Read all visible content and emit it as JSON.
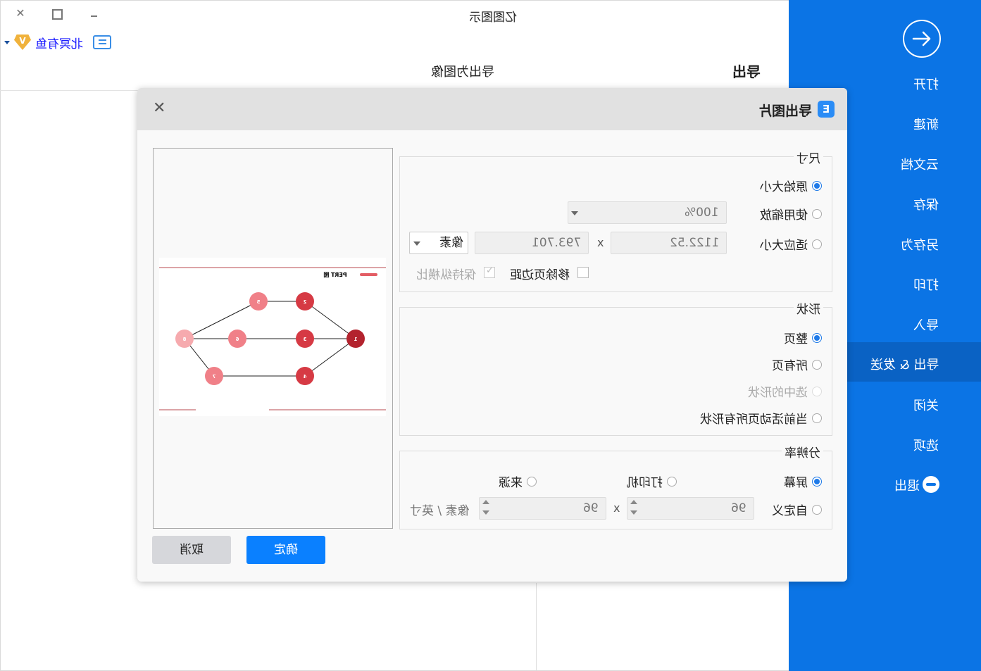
{
  "app": {
    "window_title": "亿图图示",
    "user_name": "北冥有鱼",
    "section_title": "导出",
    "sub_title": "导出为图像"
  },
  "sidebar": {
    "items": [
      {
        "label": "打开"
      },
      {
        "label": "新建"
      },
      {
        "label": "云文档"
      },
      {
        "label": "保存"
      },
      {
        "label": "另存为"
      },
      {
        "label": "打印"
      },
      {
        "label": "导入"
      },
      {
        "label": "导出 & 发送",
        "active": true
      },
      {
        "label": "关闭"
      },
      {
        "label": "选项"
      },
      {
        "label": "退出"
      }
    ]
  },
  "dialog": {
    "title": "导出图片",
    "size": {
      "legend": "尺寸",
      "original": "原始大小",
      "use_zoom": "使用缩放",
      "zoom_value": "100%",
      "fit_size": "适应大小",
      "width": "1122.52",
      "height": "793.701",
      "times": "x",
      "unit": "像素",
      "remove_margin": "移除页边距",
      "keep_ratio": "保持纵横比"
    },
    "shape": {
      "legend": "形状",
      "whole_page": "整页",
      "all_pages": "所有页",
      "selected": "选中的形状",
      "current_page_all": "当前活动页所有形状"
    },
    "resolution": {
      "legend": "分辨率",
      "screen": "屏幕",
      "printer": "打印机",
      "source": "来源",
      "custom": "自定义",
      "dpi_x": "96",
      "dpi_y": "96",
      "times": "x",
      "unit": "像素 / 英寸"
    },
    "ok_label": "确定",
    "cancel_label": "取消",
    "preview": {
      "title": "PERT 图",
      "nodes": [
        "1",
        "2",
        "3",
        "4",
        "5",
        "6",
        "7",
        "8"
      ]
    }
  },
  "colors": {
    "accent": "#0b74e5",
    "primary_button": "#0a80ff",
    "node_dark": "#b3232e",
    "node_mid": "#d63a44",
    "node_light": "#f08088",
    "node_pale": "#f6aaae"
  }
}
